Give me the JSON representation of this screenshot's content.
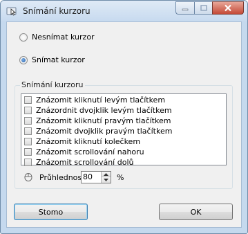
{
  "window": {
    "title": "Snímání kurzoru"
  },
  "radios": [
    {
      "label": "Nesnímat kurzor",
      "selected": false
    },
    {
      "label": "Snímat kurzor",
      "selected": true
    }
  ],
  "group": {
    "title": "Snímání kurzoru",
    "items": [
      {
        "label": "Znázomit kliknutí levým tlačítkem",
        "checked": false
      },
      {
        "label": "Znázordnit dvojklik levým tlačítkem",
        "checked": false
      },
      {
        "label": "Znázomit kliknutí pravým tlačítkem",
        "checked": false
      },
      {
        "label": "Znázomit dvojklik pravým tlačítkem",
        "checked": false
      },
      {
        "label": "Znázomit kliknutí kolečkem",
        "checked": false
      },
      {
        "label": "Znázomit scrollování nahoru",
        "checked": false
      },
      {
        "label": "Znázomit scrollování dolů",
        "checked": false
      }
    ],
    "transparency": {
      "label": "Průhlednost",
      "value": "80",
      "unit": "%"
    }
  },
  "buttons": {
    "stop": "Stomo",
    "ok": "OK"
  },
  "colors": {
    "selected_radio": "#1f5aa6",
    "default_button_border": "#3c7fb1"
  }
}
